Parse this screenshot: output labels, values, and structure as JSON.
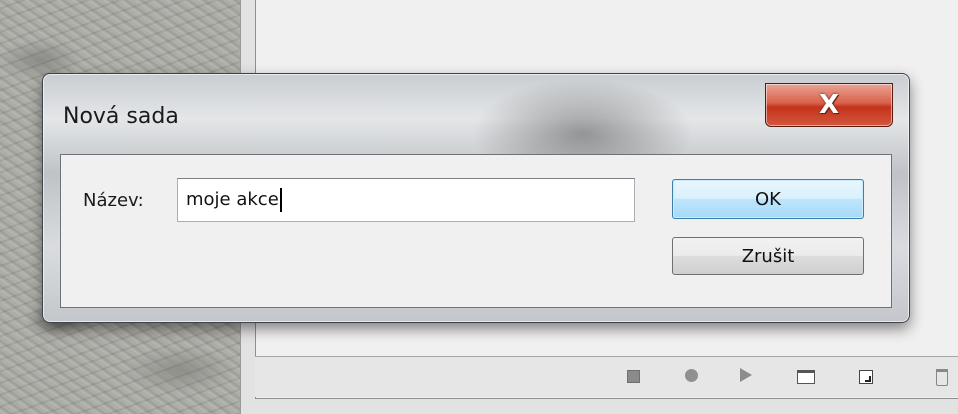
{
  "dialog": {
    "title": "Nová sada",
    "close_label": "X",
    "name_label": "Název:",
    "name_value": "moje akce",
    "ok_label": "OK",
    "cancel_label": "Zrušit"
  },
  "panel_toolbar": {
    "icons": [
      "stop-icon",
      "record-icon",
      "play-icon",
      "new-set-folder-icon",
      "new-action-icon",
      "trash-icon"
    ]
  },
  "colors": {
    "ok_border": "#3c7fb1",
    "close_red": "#c3331c",
    "panel_bg": "#f0f0f0"
  }
}
